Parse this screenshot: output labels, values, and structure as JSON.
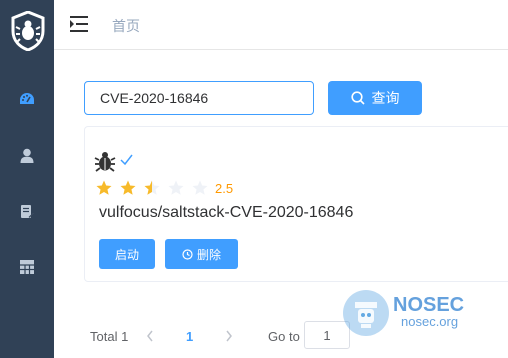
{
  "sidebar": {
    "logo_icon": "shield-bug-icon",
    "items": [
      {
        "icon": "dashboard-icon",
        "active": true
      },
      {
        "icon": "user-icon"
      },
      {
        "icon": "document-edit-icon"
      },
      {
        "icon": "grid-table-icon"
      }
    ]
  },
  "header": {
    "menu_icon": "menu-fold-icon",
    "breadcrumb": "首页"
  },
  "search": {
    "value": "CVE-2020-16846",
    "button_label": "查询"
  },
  "card": {
    "rating": 2.5,
    "rating_text": "2.5",
    "max_rating": 5,
    "name": "vulfocus/saltstack-CVE-2020-16846",
    "start_label": "启动",
    "delete_label": "删除"
  },
  "pagination": {
    "total_text": "Total 1",
    "current_page": "1",
    "goto_label": "Go to",
    "goto_value": "1"
  },
  "watermark": {
    "title": "NOSEC",
    "subtitle": "nosec.org"
  },
  "colors": {
    "accent": "#409eff",
    "sidebar_bg": "#304156",
    "star": "#f7ba2a",
    "rating_text": "#ff9900"
  }
}
